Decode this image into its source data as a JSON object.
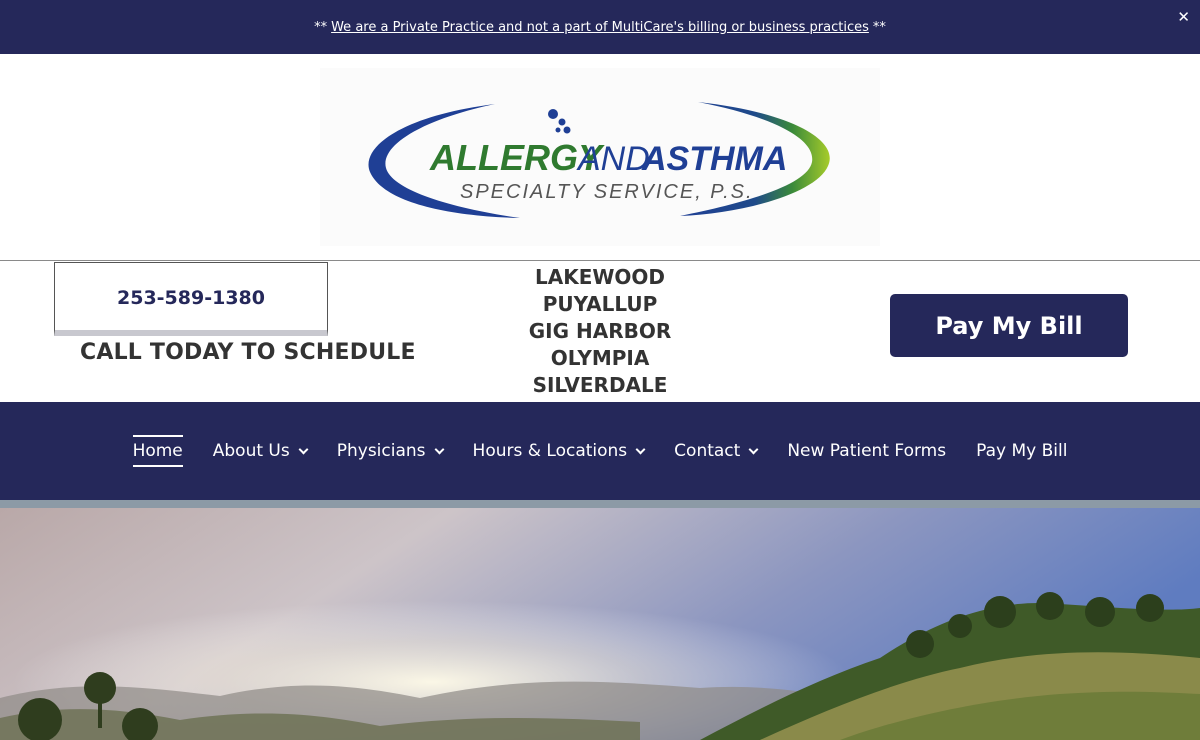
{
  "announcement": {
    "prefix": "**",
    "link_text": "We are a Private Practice and not a part of MultiCare's billing or business practices",
    "suffix": "**",
    "close_label": "✕"
  },
  "logo": {
    "line1_a": "ALLERGY",
    "line1_b": "AND",
    "line1_c": "ASTHMA",
    "line2": "SPECIALTY SERVICE, P.S."
  },
  "contact": {
    "phone": "253-589-1380",
    "cta": "CALL TODAY TO SCHEDULE"
  },
  "locations": [
    "LAKEWOOD",
    "PUYALLUP",
    "GIG HARBOR",
    "OLYMPIA",
    "SILVERDALE"
  ],
  "pay_button": "Pay My Bill",
  "nav": {
    "items": [
      {
        "label": "Home",
        "active": true,
        "dropdown": false
      },
      {
        "label": "About Us",
        "active": false,
        "dropdown": true
      },
      {
        "label": "Physicians",
        "active": false,
        "dropdown": true
      },
      {
        "label": "Hours & Locations",
        "active": false,
        "dropdown": true
      },
      {
        "label": "Contact",
        "active": false,
        "dropdown": true
      },
      {
        "label": "New Patient Forms",
        "active": false,
        "dropdown": false
      },
      {
        "label": "Pay My Bill",
        "active": false,
        "dropdown": false
      }
    ]
  },
  "colors": {
    "brand_navy": "#25285a",
    "logo_blue": "#1f3f95",
    "logo_green": "#5f9e2a"
  }
}
